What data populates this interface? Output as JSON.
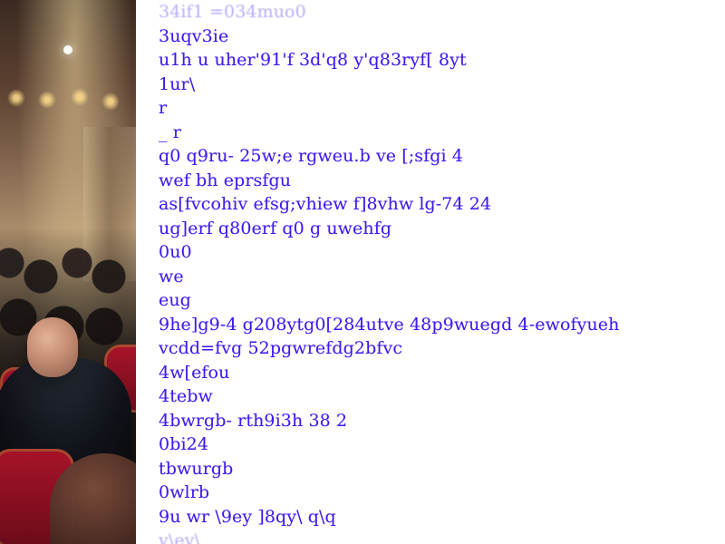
{
  "photo": {
    "alt": "conference audience photo"
  },
  "text_panel": {
    "lines": [
      "34if1 =034muo0",
      "3uqv3ie",
      "u1h u uher'91'f 3d'q8 y'q83ryf[ 8yt",
      "1ur\\",
      "r",
      "_ r",
      "q0 q9ru- 25w;e rgweu.b ve [;sfgi 4",
      "wef bh eprsfgu",
      "as[fvcohiv efsg;vhiew f]8vhw lg-74 24",
      "ug]erf q80erf q0 g uwehfg",
      "0u0",
      "we",
      "eug",
      "9he]g9-4 g208ytg0[284utve 48p9wuegd 4-ewofyueh",
      "vcdd=fvg 52pgwrefdg2bfvc",
      "4w[efou",
      "4tebw",
      "4bwrgb- rth9i3h 38 2",
      "0bi24",
      "tbwurgb",
      "0wlrb",
      "9u wr \\9ey ]8qy\\ q\\q",
      "y\\ey\\"
    ],
    "line_color": "#3d1bf0"
  }
}
